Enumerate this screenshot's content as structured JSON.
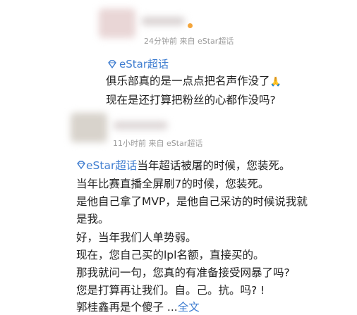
{
  "post1": {
    "meta": "24分钟前 来自 eStar超话",
    "topic": "eStar超话",
    "lines": [
      "俱乐部真的是一点点把名声作没了",
      "现在是还打算把粉丝的心都作没吗?"
    ],
    "emoji": "🙏"
  },
  "post2": {
    "meta": "11小时前 来自 eStar超话",
    "topic": "eStar超话",
    "first_line": "当年超话被屠的时候，您装死。",
    "lines": [
      "当年比赛直播全屏刷7的时候，您装死。",
      "是他自己拿了MVP，是他自己采访的时候说我就",
      "是我。",
      "好，当年我们人单势弱。",
      "现在，您自己买的lpl名额，直接买的。",
      "那我就问一句，您真的有准备接受网暴了吗?",
      "您是打算再让我们。自。己。抗。吗?  !",
      "郭桂鑫再是个傻子 ..."
    ],
    "more_link": "全文"
  },
  "colors": {
    "link": "#3f7dd0",
    "meta": "#9a9a9a",
    "text": "#222222"
  }
}
